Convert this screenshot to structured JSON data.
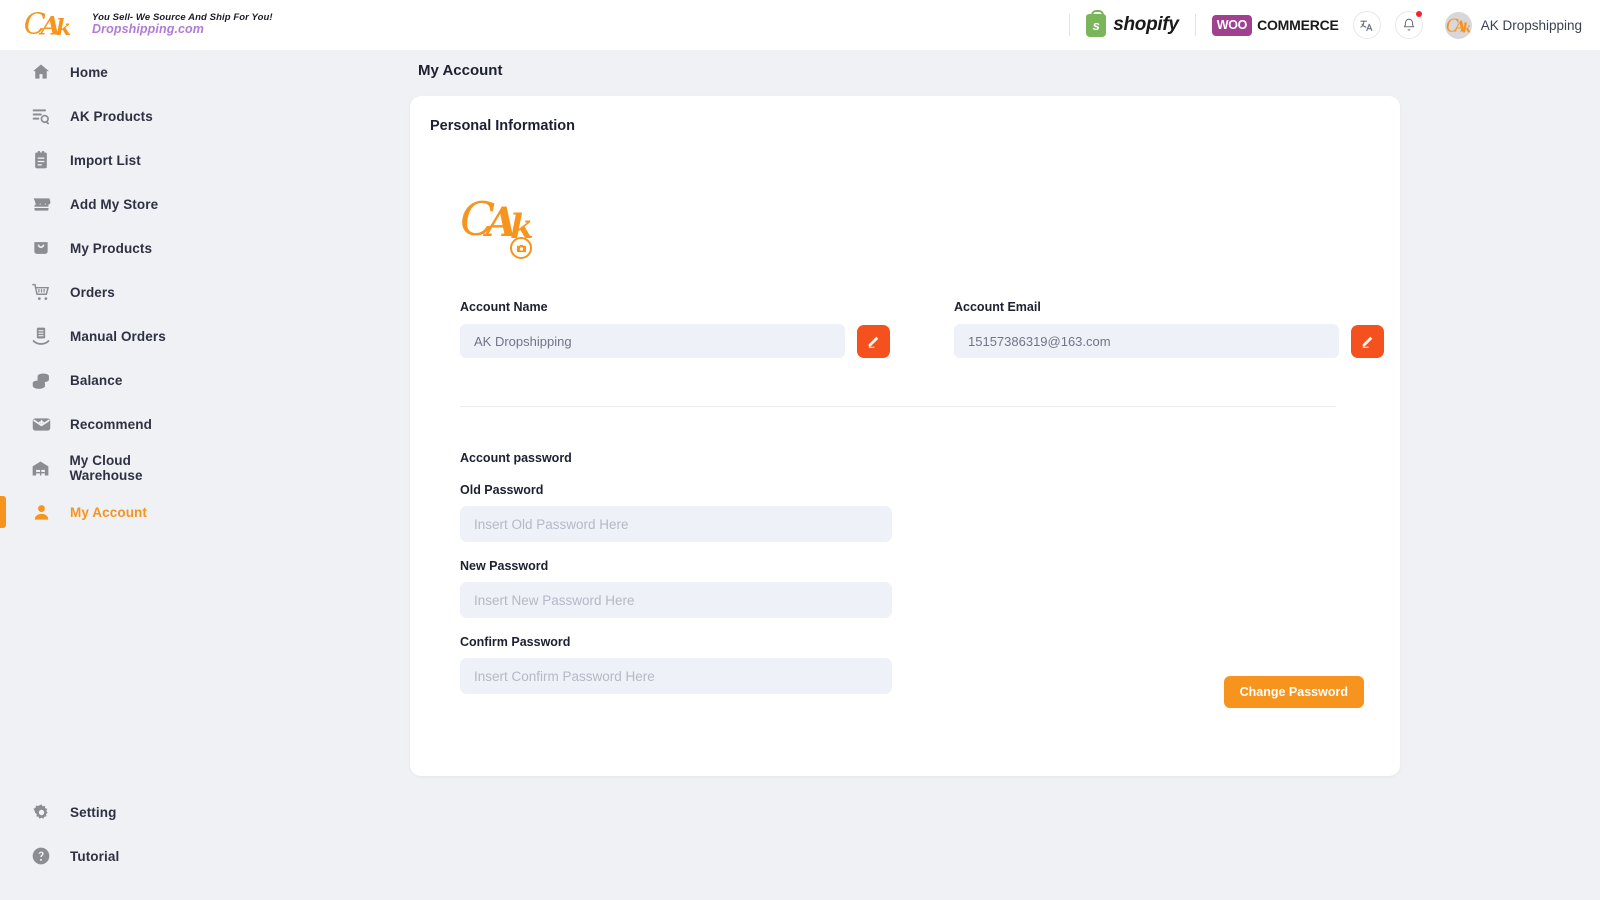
{
  "brand": {
    "logo_alt": "AK Dropshipping logo",
    "tagline": "You Sell- We Source And Ship For You!",
    "domain": "Dropshipping.com",
    "mark_letters": "AK"
  },
  "topbar": {
    "shopify_label": "shopify",
    "shopify_mark": "s",
    "woo_mark": "WOO",
    "woo_label": "COMMERCE",
    "translate_icon": "translate-icon",
    "bell_icon": "bell-icon",
    "has_notification": true,
    "user_name": "AK Dropshipping",
    "avatar_letters": "AK"
  },
  "sidebar": {
    "items": [
      {
        "label": "Home",
        "icon": "home-icon",
        "active": false
      },
      {
        "label": "AK Products",
        "icon": "product-search-icon",
        "active": false
      },
      {
        "label": "Import List",
        "icon": "clipboard-icon",
        "active": false
      },
      {
        "label": "Add My Store",
        "icon": "store-icon",
        "active": false
      },
      {
        "label": "My Products",
        "icon": "shopping-bag-icon",
        "active": false
      },
      {
        "label": "Orders",
        "icon": "cart-icon",
        "active": false
      },
      {
        "label": "Manual Orders",
        "icon": "manual-order-icon",
        "active": false
      },
      {
        "label": "Balance",
        "icon": "coins-icon",
        "active": false
      },
      {
        "label": "Recommend",
        "icon": "envelope-plus-icon",
        "active": false
      },
      {
        "label": "My Cloud Warehouse",
        "icon": "warehouse-icon",
        "active": false
      },
      {
        "label": "My Account",
        "icon": "user-icon",
        "active": true
      }
    ],
    "bottom_items": [
      {
        "label": "Setting",
        "icon": "gear-icon"
      },
      {
        "label": "Tutorial",
        "icon": "help-circle-icon"
      }
    ]
  },
  "main": {
    "page_title": "My Account",
    "card_title": "Personal Information",
    "avatar": {
      "letters": "AK",
      "badge_icon": "camera-icon"
    },
    "account_name": {
      "label": "Account Name",
      "value": "AK Dropshipping",
      "edit_icon": "pencil-icon"
    },
    "account_email": {
      "label": "Account Email",
      "value": "15157386319@163.com",
      "edit_icon": "pencil-icon"
    },
    "password_section": {
      "heading": "Account password",
      "old_password": {
        "label": "Old Password",
        "value": "",
        "placeholder": "Insert Old Password Here"
      },
      "new_password": {
        "label": "New Password",
        "value": "",
        "placeholder": "Insert New Password Here"
      },
      "confirm_password": {
        "label": "Confirm Password",
        "value": "",
        "placeholder": "Insert Confirm Password Here"
      },
      "submit_label": "Change Password"
    }
  },
  "colors": {
    "accent_orange": "#f7941d",
    "edit_orange": "#f4511e",
    "shopify_green": "#7ab55c",
    "woo_purple": "#a0418f",
    "page_bg": "#f0f1f4",
    "input_bg": "#eef1f7",
    "notification_red": "#f5222d"
  }
}
